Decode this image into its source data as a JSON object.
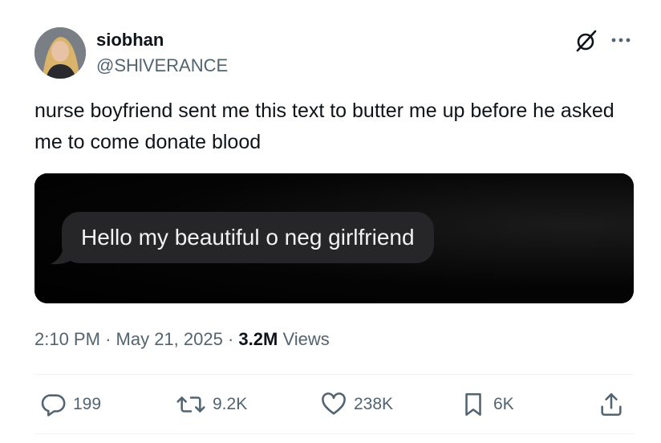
{
  "author": {
    "name": "siobhan",
    "handle": "@SHlVERANCE"
  },
  "tweet": {
    "text": "nurse boyfriend sent me this text to butter me up before he asked me to come donate blood",
    "media_message": "Hello my beautiful o neg girlfriend",
    "time": "2:10 PM",
    "date": "May 21, 2025",
    "views_count": "3.2M",
    "views_label": "Views",
    "separator": "·"
  },
  "actions": {
    "replies": "199",
    "reposts": "9.2K",
    "likes": "238K",
    "bookmarks": "6K"
  },
  "icons": [
    "grok-icon",
    "more-icon",
    "reply-icon",
    "repost-icon",
    "like-icon",
    "bookmark-icon",
    "share-icon"
  ],
  "colors": {
    "text": "#0f1419",
    "secondary": "#536471",
    "bubble": "#262628",
    "media_bg": "#000000"
  }
}
